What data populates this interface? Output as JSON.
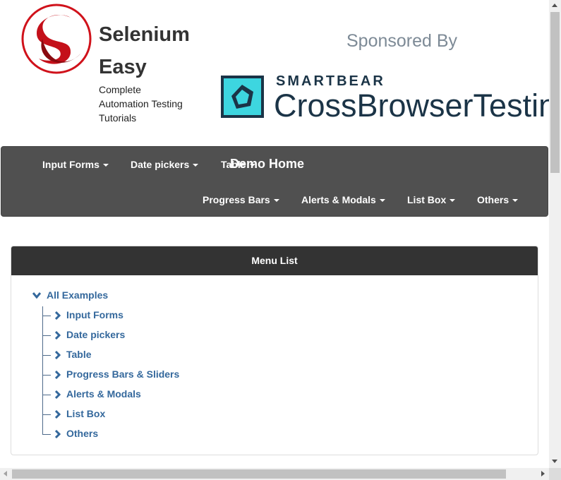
{
  "header": {
    "title_line1": "Selenium",
    "title_line2": "Easy",
    "subtitle_line1": "Complete",
    "subtitle_line2": "Automation Testing",
    "subtitle_line3": "Tutorials",
    "sponsored_by": "Sponsored By",
    "sponsor_name": "SMARTBEAR",
    "sponsor_product": "CrossBrowserTesting"
  },
  "navbar": {
    "brand": "Demo Home",
    "items": [
      {
        "label": "Input Forms"
      },
      {
        "label": "Date pickers"
      },
      {
        "label": "Table"
      },
      {
        "label": "Progress Bars"
      },
      {
        "label": "Alerts & Modals"
      },
      {
        "label": "List Box"
      },
      {
        "label": "Others"
      }
    ]
  },
  "panel": {
    "heading": "Menu List",
    "root": "All Examples",
    "items": [
      {
        "label": "Input Forms"
      },
      {
        "label": "Date pickers"
      },
      {
        "label": "Table"
      },
      {
        "label": "Progress Bars & Sliders"
      },
      {
        "label": "Alerts & Modals"
      },
      {
        "label": "List Box"
      },
      {
        "label": "Others"
      }
    ]
  },
  "colors": {
    "navbar_bg": "#505050",
    "panel_heading_bg": "#333333",
    "link": "#34689c",
    "logo_red": "#d0121b",
    "sponsor_teal": "#3dd6e0",
    "sponsor_navy": "#1b3447"
  }
}
